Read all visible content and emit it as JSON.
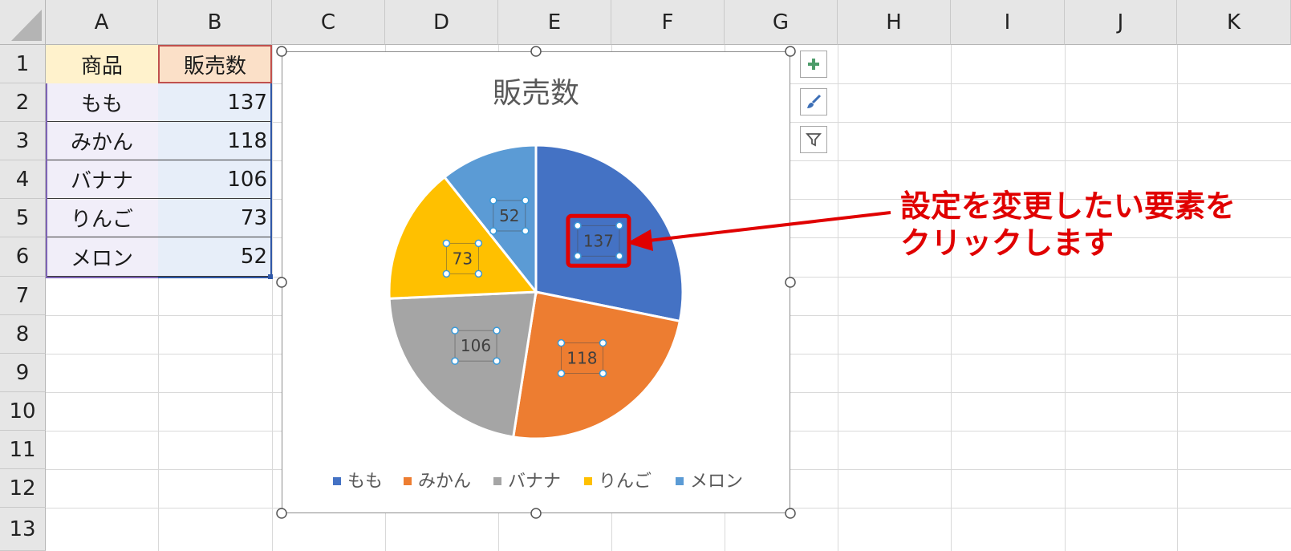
{
  "columns": [
    "A",
    "B",
    "C",
    "D",
    "E",
    "F",
    "G",
    "H",
    "I",
    "J",
    "K"
  ],
  "rows": [
    "1",
    "2",
    "3",
    "4",
    "5",
    "6",
    "7",
    "8",
    "9",
    "10",
    "11",
    "12",
    "13"
  ],
  "table": {
    "headers": [
      "商品",
      "販売数"
    ],
    "rows": [
      [
        "もも",
        "137"
      ],
      [
        "みかん",
        "118"
      ],
      [
        "バナナ",
        "106"
      ],
      [
        "りんご",
        "73"
      ],
      [
        "メロン",
        "52"
      ]
    ]
  },
  "chart_data": {
    "type": "pie",
    "title": "販売数",
    "categories": [
      "もも",
      "みかん",
      "バナナ",
      "りんご",
      "メロン"
    ],
    "values": [
      137,
      118,
      106,
      73,
      52
    ],
    "data_labels": [
      "137",
      "118",
      "106",
      "73",
      "52"
    ],
    "colors": [
      "#4472c4",
      "#ed7d31",
      "#a5a5a5",
      "#ffc000",
      "#5b9bd5"
    ],
    "legend_position": "bottom",
    "selected_labels": true,
    "highlighted_label": "137"
  },
  "chart_tools": {
    "elements_icon": "plus-icon",
    "styles_icon": "brush-icon",
    "filters_icon": "filter-icon"
  },
  "annotation": {
    "line1": "設定を変更したい要素を",
    "line2": "クリックします",
    "color": "#e00000"
  }
}
